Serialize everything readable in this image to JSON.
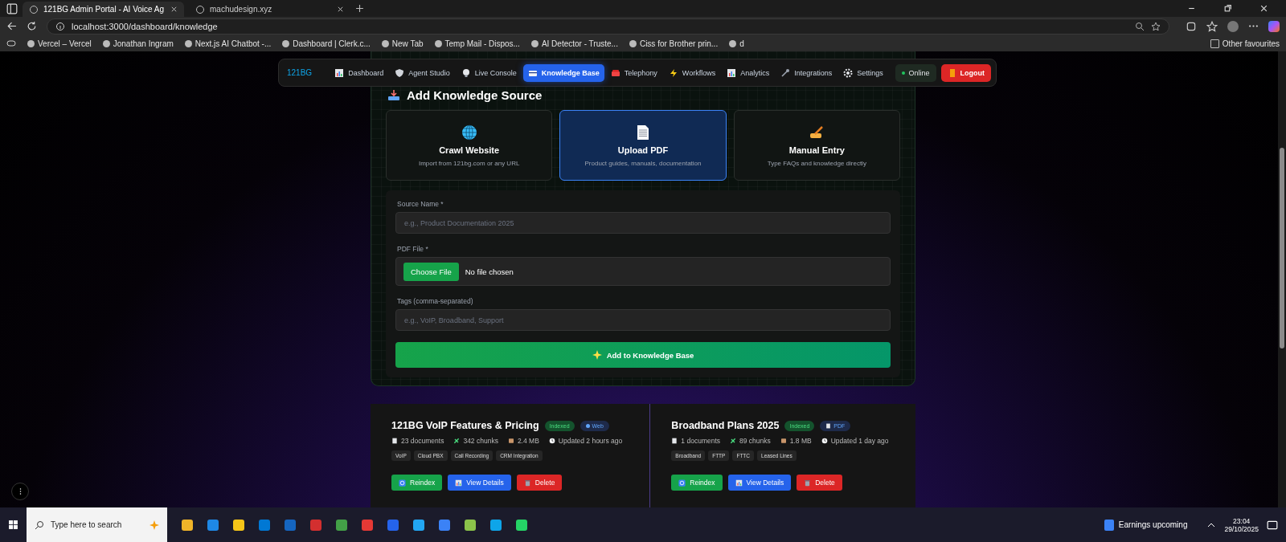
{
  "browser": {
    "tabs": [
      {
        "title": "121BG Admin Portal - AI Voice Ag",
        "selected": true
      },
      {
        "title": "machudesign.xyz",
        "selected": false
      }
    ],
    "address": "localhost:3000/dashboard/knowledge",
    "bookmarks": [
      "Vercel – Vercel",
      "Jonathan Ingram",
      "Next.js AI Chatbot -...",
      "Dashboard | Clerk.c...",
      "New Tab",
      "Temp Mail - Dispos...",
      "AI Detector - Truste...",
      "Ciss for Brother prin...",
      "d"
    ],
    "other_favourites": "Other favourites"
  },
  "nav": {
    "logo": "121BG",
    "items": [
      {
        "label": "Dashboard",
        "selected": false
      },
      {
        "label": "Agent Studio",
        "selected": false
      },
      {
        "label": "Live Console",
        "selected": false
      },
      {
        "label": "Knowledge Base",
        "selected": true
      },
      {
        "label": "Telephony",
        "selected": false
      },
      {
        "label": "Workflows",
        "selected": false
      },
      {
        "label": "Analytics",
        "selected": false
      },
      {
        "label": "Integrations",
        "selected": false
      },
      {
        "label": "Settings",
        "selected": false
      }
    ],
    "status": "Online",
    "logout": "Logout"
  },
  "add_source": {
    "title": "Add Knowledge Source",
    "types": [
      {
        "title": "Crawl Website",
        "description": "Import from 121bg.com or any URL",
        "selected": false
      },
      {
        "title": "Upload PDF",
        "description": "Product guides, manuals, documentation",
        "selected": true
      },
      {
        "title": "Manual Entry",
        "description": "Type FAQs and knowledge directly",
        "selected": false
      }
    ],
    "form": {
      "name_label": "Source Name *",
      "name_placeholder": "e.g., Product Documentation 2025",
      "file_label": "PDF File *",
      "file_button": "Choose File",
      "file_status": "No file chosen",
      "tags_label": "Tags (comma-separated)",
      "tags_placeholder": "e.g., VoIP, Broadband, Support",
      "submit": "Add to Knowledge Base"
    }
  },
  "sources": [
    {
      "name": "121BG VoIP Features & Pricing",
      "status": "Indexed",
      "type": {
        "label": "Web",
        "kind": "web"
      },
      "documents": "23 documents",
      "chunks": "342 chunks",
      "size": "2.4 MB",
      "updated": "Updated 2 hours ago",
      "tags": [
        "VoIP",
        "Cloud PBX",
        "Call Recording",
        "CRM Integration"
      ],
      "actions": [
        "Reindex",
        "View Details",
        "Delete"
      ]
    },
    {
      "name": "Broadband Plans 2025",
      "status": "Indexed",
      "type": {
        "label": "PDF",
        "kind": "pdf"
      },
      "documents": "1 documents",
      "chunks": "89 chunks",
      "size": "1.8 MB",
      "updated": "Updated 1 day ago",
      "tags": [
        "Broadband",
        "FTTP",
        "FTTC",
        "Leased Lines"
      ],
      "actions": [
        "Reindex",
        "View Details",
        "Delete"
      ]
    }
  ],
  "taskbar": {
    "search_placeholder": "Type here to search",
    "news": "Earnings upcoming",
    "time": "23:04",
    "date": "29/10/2025"
  }
}
